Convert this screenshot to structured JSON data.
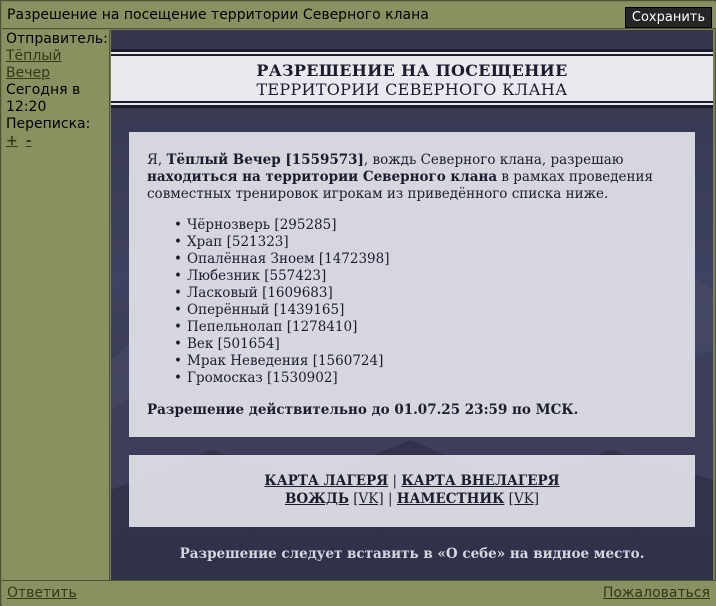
{
  "window": {
    "title": "Разрешение на посещение территории Северного клана",
    "save_label": "Сохранить"
  },
  "sidebar": {
    "sender_label": "Отправитель:",
    "sender_name_line1": "Тёплый",
    "sender_name_line2": "Вечер",
    "date_line1": "Сегодня в",
    "date_line2": "12:20",
    "thread_label": "Переписка:",
    "expand": "+",
    "collapse": "-"
  },
  "letter": {
    "header_line1": "РАЗРЕШЕНИЕ НА ПОСЕЩЕНИЕ",
    "header_line2": "ТЕРРИТОРИИ СЕВЕРНОГО КЛАНА",
    "intro_prefix": "Я, ",
    "author": "Тёплый Вечер [1559573]",
    "intro_mid": ", вождь Северного клана, разрешаю ",
    "permission": "находиться на территории Северного клана",
    "intro_suffix": " в рамках проведения совместных тренировок игрокам из приведённого списка ниже.",
    "players": [
      "Чёрнозверь [295285]",
      "Храп [521323]",
      "Опалённая Зноем [1472398]",
      "Любезник [557423]",
      "Ласковый [1609683]",
      "Оперённый [1439165]",
      "Пепельнолап [1278410]",
      "Век [501654]",
      "Мрак Неведения [1560724]",
      "Громосказ [1530902]"
    ],
    "validity": "Разрешение действительно до 01.07.25 23:59 по МСК."
  },
  "links": {
    "camp_map": "КАРТА ЛАГЕРЯ",
    "sep1": " | ",
    "outside_map": "КАРТА ВНЕЛАГЕРЯ",
    "leader": "ВОЖДЬ",
    "leader_vk": "[VK]",
    "sep2": " | ",
    "deputy": "НАМЕСТНИК",
    "deputy_vk": "[VK]"
  },
  "note": "Разрешение следует вставить в «О себе» на видное место.",
  "footer": {
    "reply": "Ответить",
    "report": "Пожаловаться"
  }
}
